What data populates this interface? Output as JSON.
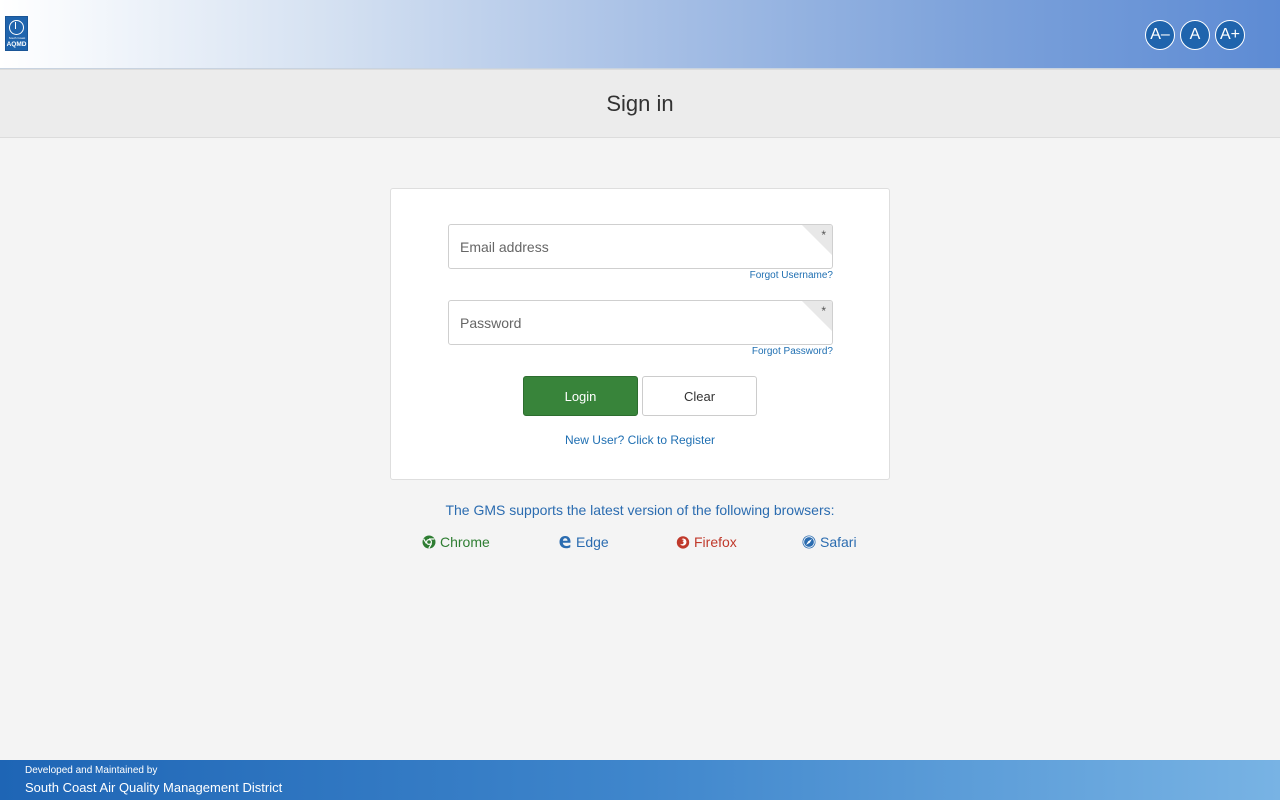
{
  "header": {
    "logo": {
      "top_text": "South Coast",
      "bottom_text": "AQMD"
    },
    "font_controls": {
      "decrease": "A–",
      "reset": "A",
      "increase": "A+"
    }
  },
  "page": {
    "title": "Sign in"
  },
  "form": {
    "email": {
      "placeholder": "Email address",
      "required_mark": "*"
    },
    "forgot_username": "Forgot Username?",
    "password": {
      "placeholder": "Password",
      "required_mark": "*"
    },
    "forgot_password": "Forgot Password?",
    "login_label": "Login",
    "clear_label": "Clear",
    "register_link": "New User? Click to Register"
  },
  "browsers": {
    "intro": "The GMS supports the latest version of the following browsers:",
    "items": [
      {
        "label": "Chrome",
        "icon": "chrome-icon",
        "color": "#2e7d32"
      },
      {
        "label": "Edge",
        "icon": "edge-icon",
        "color": "#2b6cb0"
      },
      {
        "label": "Firefox",
        "icon": "firefox-icon",
        "color": "#c0392b"
      },
      {
        "label": "Safari",
        "icon": "safari-icon",
        "color": "#2b6cb0"
      }
    ]
  },
  "footer": {
    "line1": "Developed and Maintained by",
    "line2": "South Coast Air Quality Management District"
  },
  "colors": {
    "primary_button": "#38843a",
    "link": "#1f6fb2",
    "header_accent": "#5d8bd4"
  }
}
